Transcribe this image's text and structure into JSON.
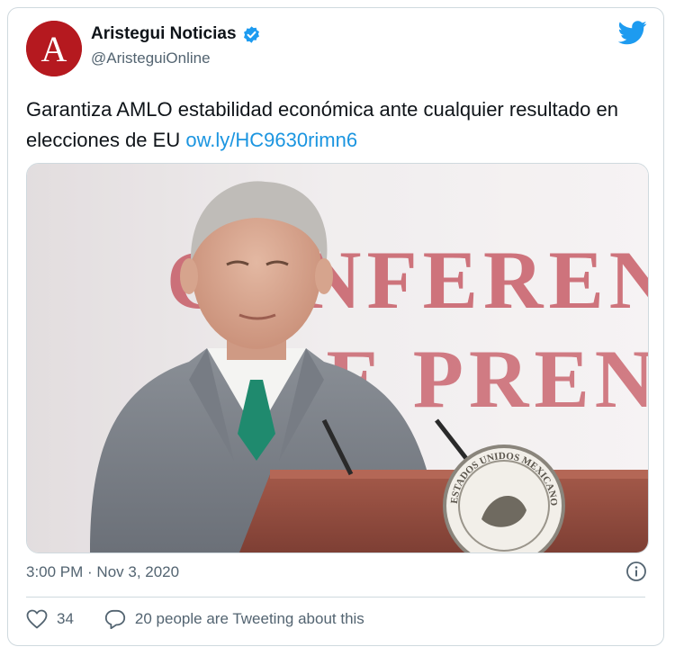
{
  "tweet": {
    "author_name": "Aristegui Noticias",
    "author_handle": "@AristeguiOnline",
    "avatar_letter": "A",
    "text": "Garantiza AMLO estabilidad económica ante cualquier resultado en elecciones de EU",
    "link_text": "ow.ly/HC9630rimn6",
    "timestamp": "3:00 PM · Nov 3, 2020",
    "likes": "34",
    "tweeting_text": "20 people are Tweeting about this",
    "media": {
      "backdrop_text_line1": "CONFERENCIA",
      "backdrop_text_line2": "DE PRENSA",
      "seal_text": "ESTADOS UNIDOS MEXICANOS"
    }
  },
  "icons": {
    "verified": "verified-badge-icon",
    "twitter": "twitter-bird-icon",
    "info": "info-icon",
    "heart": "heart-icon",
    "reply": "speech-bubble-icon"
  },
  "colors": {
    "brand_blue": "#1d9bf0",
    "link": "#1b95e0",
    "avatar_red": "#b5191f",
    "secondary_text": "#536471",
    "border": "#cfd9de"
  }
}
